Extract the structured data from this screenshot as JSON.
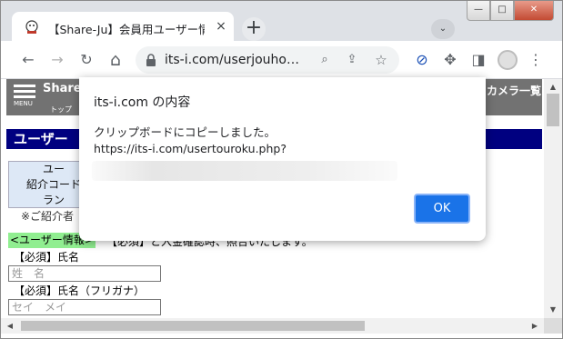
{
  "tab": {
    "title": "【Share-Ju】会員用ユーザー情",
    "close": "×"
  },
  "new_tab": "+",
  "tab_search": "⌄",
  "window": {
    "minimize": "—",
    "maximize": "□",
    "close": "✕"
  },
  "toolbar": {
    "back": "←",
    "forward": "→",
    "reload": "↻",
    "home": "⌂",
    "url": "its-i.com/userjouho…",
    "zoom": "⌕",
    "share": "⇪",
    "bookmark": "☆",
    "extension_a": "⊘",
    "extensions": "✥",
    "sidepanel": "◨",
    "menu": "⋮"
  },
  "site": {
    "name": "Share",
    "menu_label": "MENU",
    "top_link": "トップ",
    "camera_link": "カメラ一覧",
    "section_title": "ユーザー",
    "ref_box": [
      "ユー",
      "紹介コード",
      "ラン"
    ],
    "ref_note": "※ご紹介者",
    "userinfo_label": "<ユーザー情報>",
    "required_note": "【必須】と入金確認時、照合いたします。",
    "fields": [
      {
        "label": "【必須】氏名",
        "placeholder": "姓　名"
      },
      {
        "label": "【必須】氏名（フリガナ）",
        "placeholder": "セイ　メイ"
      }
    ]
  },
  "dialog": {
    "title": "its-i.com の内容",
    "message": "クリップボードにコピーしました。",
    "url": "https://its-i.com/usertouroku.php?",
    "ok_label": "OK"
  },
  "colors": {
    "ok_button": "#1a73e8",
    "section_title_bg": "#000080",
    "header_bg": "#727272",
    "userinfo_label_bg": "#90ee90"
  }
}
